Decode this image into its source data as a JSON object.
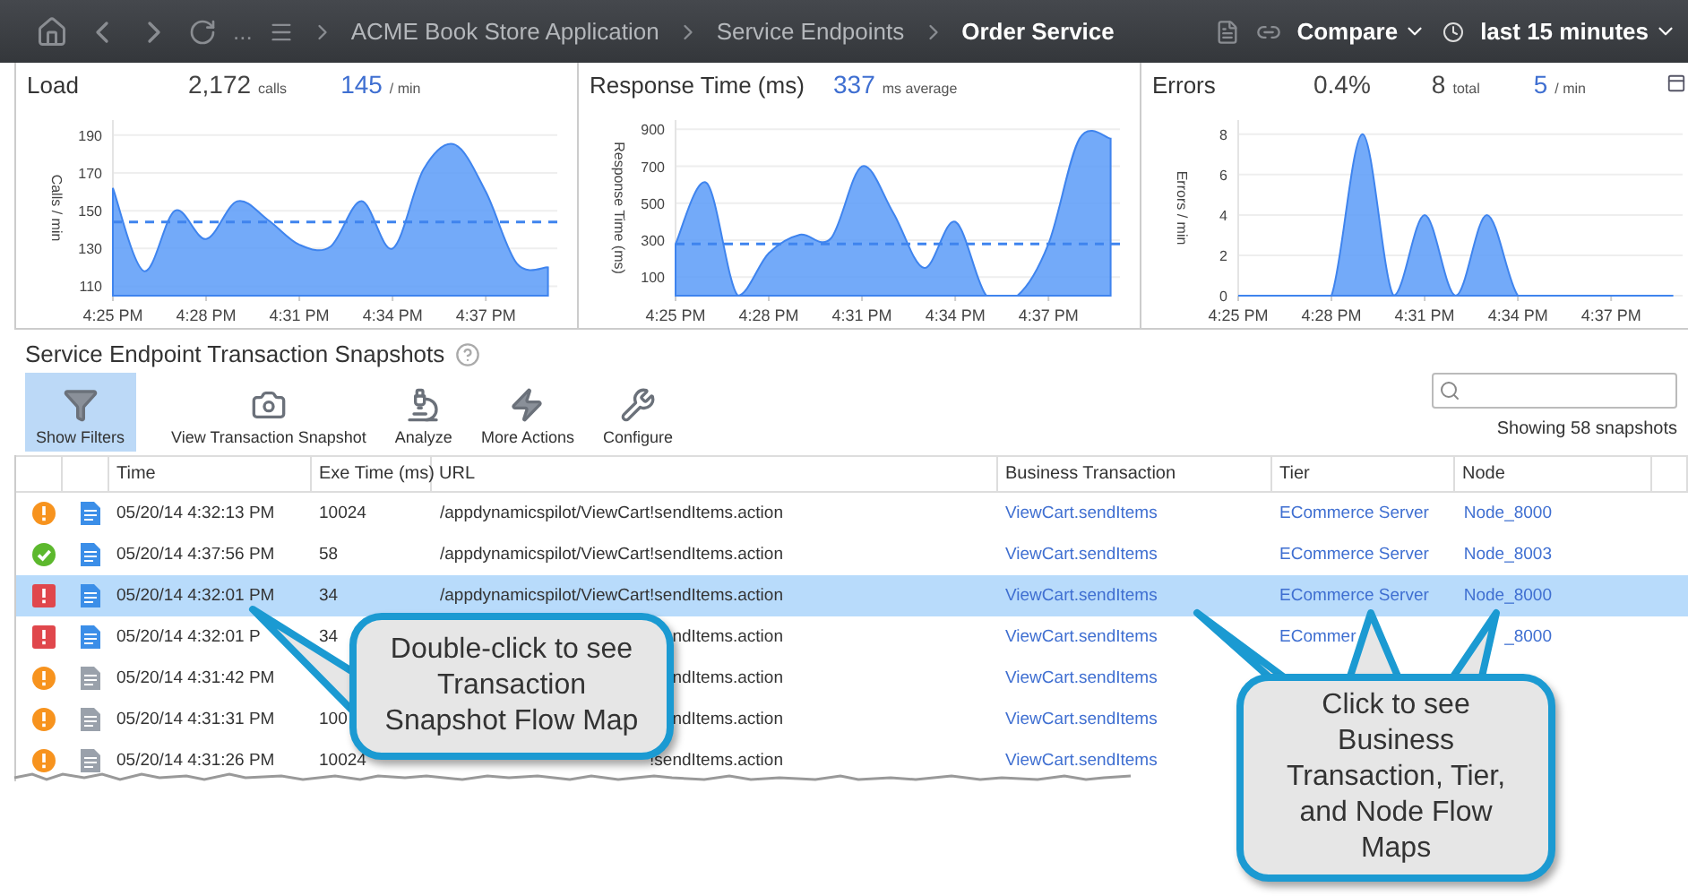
{
  "nav": {
    "ellipsis": "...",
    "breadcrumbs": [
      {
        "label": "ACME Book Store Application",
        "current": false
      },
      {
        "label": "Service Endpoints",
        "current": false
      },
      {
        "label": "Order Service",
        "current": true
      }
    ],
    "compare": "Compare",
    "time_range": "last 15 minutes"
  },
  "panels": [
    {
      "title": "Load",
      "stats": [
        {
          "value": "2,172",
          "unit": "calls",
          "highlight": false
        },
        {
          "value": "145",
          "unit": "/ min",
          "highlight": true
        }
      ],
      "chart_data": {
        "type": "area",
        "ylabel": "Calls / min",
        "categories": [
          "4:25 PM",
          null,
          null,
          "4:28 PM",
          null,
          null,
          "4:31 PM",
          null,
          null,
          "4:34 PM",
          null,
          null,
          "4:37 PM",
          null,
          null
        ],
        "ylim": [
          105,
          198
        ],
        "yticks": [
          110,
          130,
          150,
          170,
          190
        ],
        "series": [
          {
            "color": "#5b9bf8",
            "values": [
              162,
              118,
              150,
              135,
              155,
              145,
              132,
              131,
              155,
              130,
              172,
              185,
              160,
              122,
              120
            ]
          }
        ],
        "grid": true,
        "ref_lines": [
          {
            "axis": "y",
            "value": 144
          }
        ]
      }
    },
    {
      "title": "Response Time (ms)",
      "stats": [
        {
          "value": "337",
          "unit": "ms average",
          "highlight": true
        }
      ],
      "chart_data": {
        "type": "area",
        "ylabel": "Response Time (ms)",
        "categories": [
          "4:25 PM",
          null,
          null,
          "4:28 PM",
          null,
          null,
          "4:31 PM",
          null,
          null,
          "4:34 PM",
          null,
          null,
          "4:37 PM",
          null,
          null
        ],
        "ylim": [
          0,
          950
        ],
        "yticks": [
          100,
          300,
          500,
          700,
          900
        ],
        "series": [
          {
            "color": "#5b9bf8",
            "values": [
              280,
              610,
              0,
              230,
              330,
              310,
              700,
              450,
              150,
              400,
              0,
              0,
              280,
              850,
              850
            ]
          }
        ],
        "grid": true,
        "ref_lines": [
          {
            "axis": "y",
            "value": 280
          }
        ]
      }
    },
    {
      "title": "Errors",
      "stats": [
        {
          "value": "0.4%",
          "highlight": false
        },
        {
          "value": "8",
          "unit": "total",
          "highlight": false
        },
        {
          "value": "5",
          "unit": "/ min",
          "highlight": true
        }
      ],
      "chart_data": {
        "type": "area",
        "ylabel": "Errors / min",
        "categories": [
          "4:25 PM",
          null,
          null,
          "4:28 PM",
          null,
          null,
          "4:31 PM",
          null,
          null,
          "4:34 PM",
          null,
          null,
          "4:37 PM",
          null,
          null
        ],
        "ylim": [
          0,
          8.7
        ],
        "yticks": [
          0,
          2,
          4,
          6,
          8
        ],
        "series": [
          {
            "color": "#5b9bf8",
            "values": [
              0,
              0,
              0,
              0,
              8,
              0,
              4,
              0,
              4,
              0,
              0,
              0,
              0,
              0,
              0
            ]
          }
        ],
        "grid": true
      }
    }
  ],
  "snapshots": {
    "title": "Service Endpoint Transaction Snapshots",
    "toolbar": [
      {
        "label": "Show Filters",
        "active": true
      },
      {
        "label": "View Transaction Snapshot",
        "active": false
      },
      {
        "label": "Analyze",
        "active": false
      },
      {
        "label": "More Actions",
        "active": false
      },
      {
        "label": "Configure",
        "active": false
      }
    ],
    "count": "Showing 58 snapshots",
    "columns": [
      "Time",
      "Exe Time (ms)",
      "URL",
      "Business Transaction",
      "Tier",
      "Node"
    ],
    "rows": [
      {
        "kind": "warning",
        "full_snapshot": true,
        "selected": false,
        "time": "05/20/14 4:32:13 PM",
        "exe": "10024",
        "url": "/appdynamicspilot/ViewCart!sendItems.action",
        "bt": "ViewCart.sendItems",
        "tier": "ECommerce Server",
        "node": "Node_8000"
      },
      {
        "kind": "ok",
        "full_snapshot": true,
        "selected": false,
        "time": "05/20/14 4:37:56 PM",
        "exe": "58",
        "url": "/appdynamicspilot/ViewCart!sendItems.action",
        "bt": "ViewCart.sendItems",
        "tier": "ECommerce Server",
        "node": "Node_8003"
      },
      {
        "kind": "error",
        "full_snapshot": true,
        "selected": true,
        "time": "05/20/14 4:32:01 PM",
        "exe": "34",
        "url": "/appdynamicspilot/ViewCart!sendItems.action",
        "bt": "ViewCart.sendItems",
        "tier": "ECommerce Server",
        "node": "Node_8000"
      },
      {
        "kind": "error",
        "full_snapshot": true,
        "selected": false,
        "time": "05/20/14 4:32:01 P",
        "exe": "34",
        "url": "ndItems.action",
        "bt": "ViewCart.sendItems",
        "tier": "ECommer",
        "node": "_8000"
      },
      {
        "kind": "warning",
        "full_snapshot": false,
        "selected": false,
        "time": "05/20/14 4:31:42 PM",
        "url": "ndItems.action",
        "bt": "ViewCart.sendItems"
      },
      {
        "kind": "warning",
        "full_snapshot": false,
        "selected": false,
        "time": "05/20/14 4:31:31 PM",
        "exe": "100",
        "url": "ndItems.action",
        "bt": "ViewCart.sendItems"
      },
      {
        "kind": "warning",
        "full_snapshot": false,
        "selected": false,
        "time": "05/20/14 4:31:26 PM",
        "exe": "10024",
        "url": "!sendItems.action",
        "bt": "ViewCart.sendItems"
      }
    ]
  },
  "callouts": [
    "Double-click to see Transaction Snapshot Flow Map",
    "Click to see Business Transaction, Tier, and Node Flow Maps"
  ]
}
